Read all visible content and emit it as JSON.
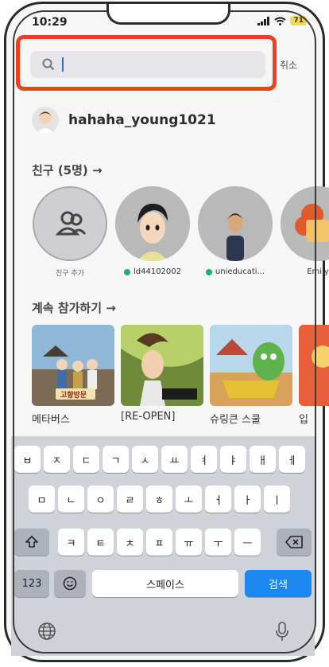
{
  "status_bar": {
    "time": "10:29",
    "battery": "71"
  },
  "search": {
    "placeholder": "",
    "value": "",
    "cancel_label": "취소"
  },
  "user": {
    "username": "hahaha_young1021"
  },
  "friends_section": {
    "title": "친구 (5명) →",
    "add_label": "친구 추가",
    "friends": [
      {
        "name": "ld44102002",
        "online": true
      },
      {
        "name": "unieducati...",
        "online": true
      },
      {
        "name": "Emily",
        "online": false
      }
    ]
  },
  "continue_section": {
    "title": "계속 참가하기 →",
    "games": [
      {
        "name": "메타버스",
        "thumb_text": "고향방문"
      },
      {
        "name": "[RE-OPEN]",
        "thumb_text": ""
      },
      {
        "name": "슈링큰 스쿨",
        "thumb_text": ""
      },
      {
        "name": "입",
        "thumb_text": ""
      }
    ]
  },
  "keyboard": {
    "row1": [
      "ㅂ",
      "ㅈ",
      "ㄷ",
      "ㄱ",
      "ㅅ",
      "ㅛ",
      "ㅕ",
      "ㅑ",
      "ㅐ",
      "ㅔ"
    ],
    "row2": [
      "ㅁ",
      "ㄴ",
      "ㅇ",
      "ㄹ",
      "ㅎ",
      "ㅗ",
      "ㅓ",
      "ㅏ",
      "ㅣ"
    ],
    "row3": [
      "ㅋ",
      "ㅌ",
      "ㅊ",
      "ㅍ",
      "ㅠ",
      "ㅜ",
      "ㅡ"
    ],
    "num_label": "123",
    "space_label": "스페이스",
    "search_label": "검색"
  },
  "colors": {
    "highlight": "#ee4020",
    "online": "#1fb16b",
    "search_key": "#1e88f2"
  }
}
